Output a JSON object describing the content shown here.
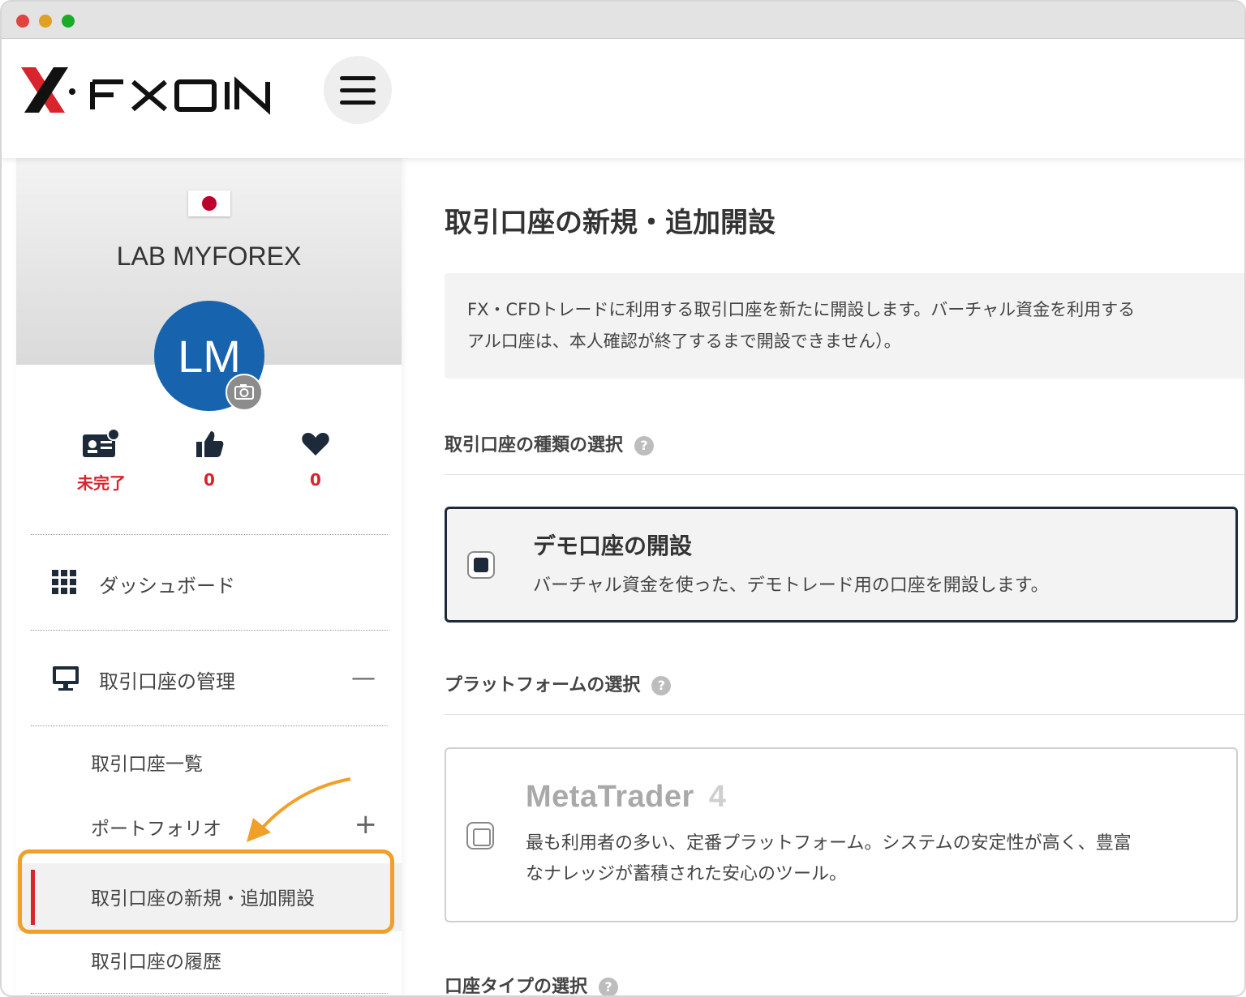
{
  "header": {
    "brand": "FXON"
  },
  "profile": {
    "name": "LAB MYFOREX",
    "initials": "LM",
    "stats": [
      {
        "icon": "id-card-icon",
        "value": "未完了"
      },
      {
        "icon": "thumbs-up-icon",
        "value": "0"
      },
      {
        "icon": "heart-icon",
        "value": "0"
      }
    ]
  },
  "nav": {
    "dashboard": "ダッシュボード",
    "account_mgmt": "取引口座の管理",
    "account_mgmt_toggle": "—",
    "sub": {
      "list": "取引口座一覧",
      "portfolio": "ポートフォリオ",
      "portfolio_toggle": "+",
      "new": "取引口座の新規・追加開設",
      "history": "取引口座の履歴"
    }
  },
  "main": {
    "title": "取引口座の新規・追加開設",
    "info_line1": "FX・CFDトレードに利用する取引口座を新たに開設します。バーチャル資金を利用する",
    "info_line2": "アル口座は、本人確認が終了するまで開設できません）。",
    "section_type": "取引口座の種類の選択",
    "section_platform": "プラットフォームの選択",
    "section_acct_type": "口座タイプの選択",
    "help_glyph": "?",
    "demo_card": {
      "title": "デモ口座の開設",
      "desc": "バーチャル資金を使った、デモトレード用の口座を開設します。"
    },
    "mt4_card": {
      "title": "MetaTrader",
      "title_num": "4",
      "desc_line1": "最も利用者の多い、定番プラットフォーム。システムの安定性が高く、豊富",
      "desc_line2": "なナレッジが蓄積された安心のツール。"
    }
  },
  "colors": {
    "accent_red": "#d9232d",
    "avatar_blue": "#1763ad",
    "highlight_orange": "#f0a02a"
  }
}
